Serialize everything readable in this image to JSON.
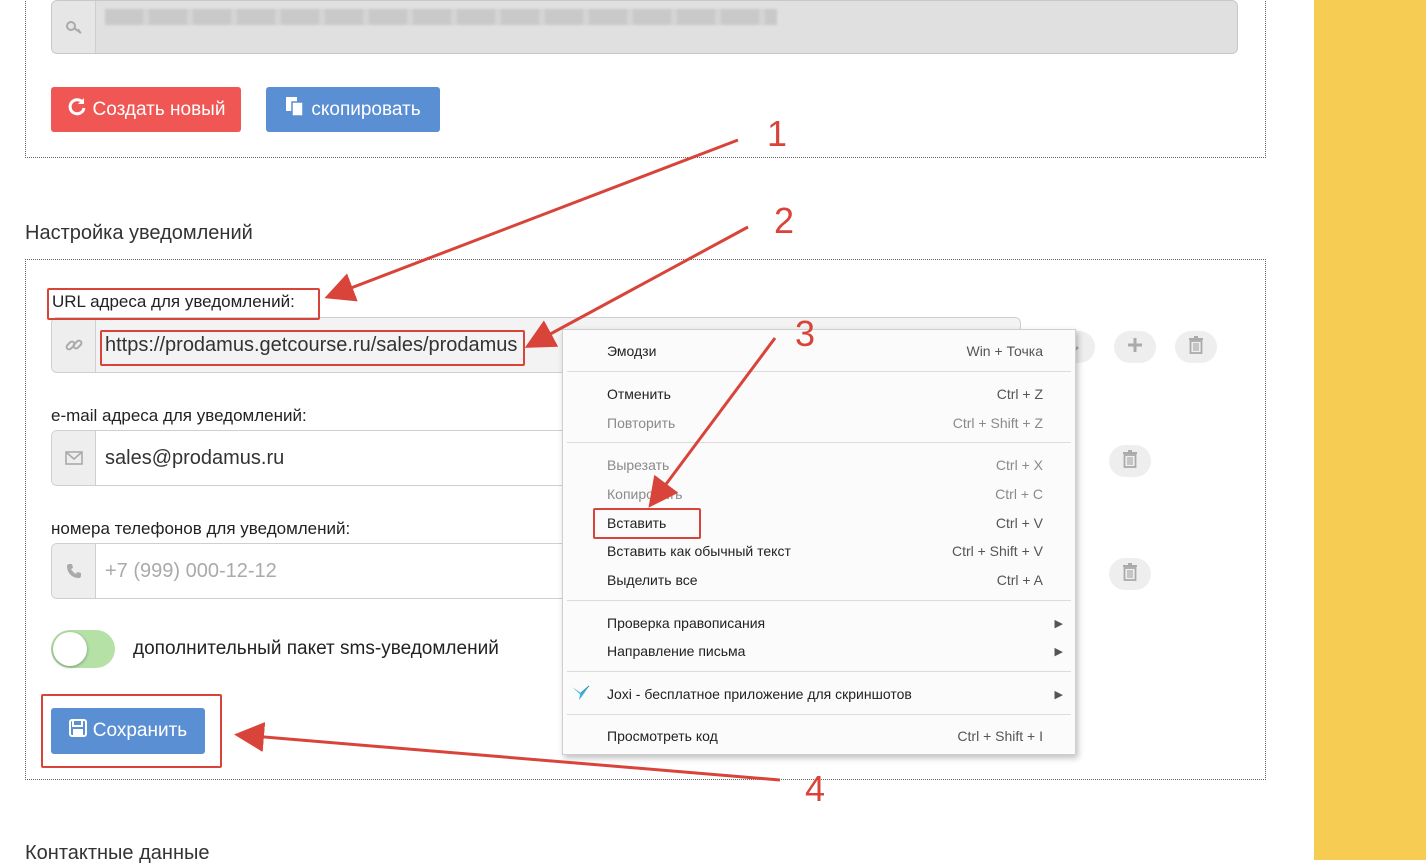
{
  "top_section": {
    "buttons": {
      "create_new": "Создать новый",
      "copy": "скопировать"
    }
  },
  "notifications": {
    "heading": "Настройка уведомлений",
    "url_label": "URL адреса для уведомлений:",
    "url_value": "https://prodamus.getcourse.ru/sales/prodamus",
    "email_label": "e-mail адреса для уведомлений:",
    "email_value": "sales@prodamus.ru",
    "phone_label": "номера телефонов для уведомлений:",
    "phone_placeholder": "+7 (999) 000-12-12",
    "sms_toggle_label": "дополнительный пакет sms-уведомлений",
    "save_button": "Сохранить"
  },
  "next_section_heading": "Контактные данные",
  "context_menu": {
    "items": [
      {
        "label": "Эмодзи",
        "shortcut": "Win + Точка"
      },
      {
        "label": "Отменить",
        "shortcut": "Ctrl + Z"
      },
      {
        "label": "Повторить",
        "shortcut": "Ctrl + Shift + Z"
      },
      {
        "label": "Вырезать",
        "shortcut": "Ctrl + X"
      },
      {
        "label": "Копировать",
        "shortcut": "Ctrl + C"
      },
      {
        "label": "Вставить",
        "shortcut": "Ctrl + V"
      },
      {
        "label": "Вставить как обычный текст",
        "shortcut": "Ctrl + Shift + V"
      },
      {
        "label": "Выделить все",
        "shortcut": "Ctrl + A"
      },
      {
        "label": "Проверка правописания",
        "shortcut": ""
      },
      {
        "label": "Направление письма",
        "shortcut": ""
      },
      {
        "label": "Joxi - бесплатное приложение для скриншотов",
        "shortcut": ""
      },
      {
        "label": "Просмотреть код",
        "shortcut": "Ctrl + Shift + I"
      }
    ]
  },
  "annotations": {
    "step1": "1",
    "step2": "2",
    "step3": "3",
    "step4": "4"
  },
  "colors": {
    "accent_yellow": "#f6cd52",
    "button_red": "#ef5654",
    "button_blue": "#5b8fd3",
    "annotation_red": "#d9443a",
    "toggle_green": "#b5e0a6"
  },
  "icons": {
    "key": "key-icon",
    "refresh": "refresh-icon",
    "copy": "copy-icon",
    "link": "link-icon",
    "envelope": "envelope-icon",
    "phone": "phone-icon",
    "save": "floppy-disk-icon",
    "plus": "plus-icon",
    "trash": "trash-icon",
    "joxi": "joxi-bird-icon"
  }
}
